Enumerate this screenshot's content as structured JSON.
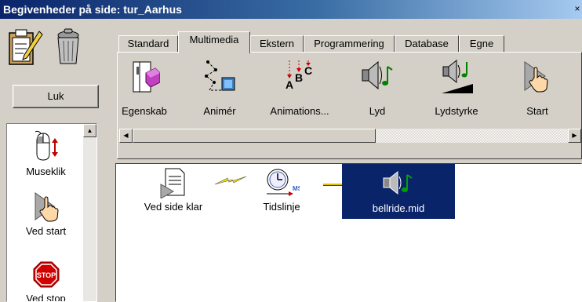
{
  "window": {
    "title": "Begivenheder på side: tur_Aarhus",
    "close_glyph": "×"
  },
  "sidebar": {
    "tools": [
      {
        "icon": "clipboard-edit-icon"
      },
      {
        "icon": "trash-icon"
      }
    ],
    "close_button": "Luk",
    "events": [
      {
        "label": "Museklik",
        "icon": "mouse-click-icon"
      },
      {
        "label": "Ved start",
        "icon": "hand-cursor-play-icon"
      },
      {
        "label": "Ved stop",
        "icon": "stop-sign-icon"
      }
    ],
    "stop_sign_text": "STOP"
  },
  "tabs": [
    {
      "label": "Standard",
      "active": false
    },
    {
      "label": "Multimedia",
      "active": true
    },
    {
      "label": "Ekstern",
      "active": false
    },
    {
      "label": "Programmering",
      "active": false
    },
    {
      "label": "Database",
      "active": false
    },
    {
      "label": "Egne",
      "active": false
    }
  ],
  "toolbar": {
    "items": [
      {
        "label": "Egenskab",
        "icon": "property-icon"
      },
      {
        "label": "Animér",
        "icon": "animate-path-icon"
      },
      {
        "label": "Animations...",
        "icon": "animation-sequence-icon",
        "glyphs": [
          "A",
          "B",
          "C"
        ]
      },
      {
        "label": "Lyd",
        "icon": "speaker-note-icon"
      },
      {
        "label": "Lydstyrke",
        "icon": "volume-icon"
      },
      {
        "label": "Start",
        "icon": "hand-cursor-play-icon"
      }
    ]
  },
  "flow": {
    "nodes": [
      {
        "label": "Ved side klar",
        "icon": "page-play-icon"
      },
      {
        "label": "Tidslinje",
        "icon": "timeline-clock-icon",
        "badge": "MS"
      },
      {
        "label": "bellride.mid",
        "icon": "speaker-note-icon",
        "selected": true
      }
    ]
  },
  "colors": {
    "selection": "#0a246a",
    "title_gradient_start": "#0a246a",
    "title_gradient_end": "#a6caf0",
    "chrome": "#d4d0c8"
  }
}
